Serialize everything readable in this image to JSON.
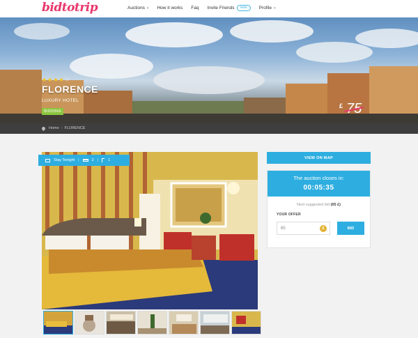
{
  "header": {
    "logo": "bidtotrip",
    "nav": [
      {
        "label": "Auctions",
        "chevron": true
      },
      {
        "label": "How it works"
      },
      {
        "label": "Faq"
      },
      {
        "label": "Invite Friends",
        "badge": "new"
      },
      {
        "label": "Profile",
        "chevron": true
      }
    ]
  },
  "hero": {
    "rating": {
      "filled": 4,
      "total": 5
    },
    "city": "FLORENCE",
    "hotel_type": "LUXURY HOTEL",
    "status_badge": "BIDDING",
    "currency": "£",
    "price": "75"
  },
  "breadcrumb": {
    "home": "Home",
    "separator": "›",
    "current": "FLORENCE"
  },
  "photo_info": {
    "stay": "Stay Tonight",
    "beds": "2",
    "baths": "1"
  },
  "thumbnails_count": 7,
  "panel": {
    "map_button": "VIEW ON MAP",
    "closes_label": "The auction closes in:",
    "countdown": "00:05:35",
    "next_bid_label": "Next suggested bid",
    "next_bid_value": "(65 £)",
    "offer_label": "YOUR OFFER",
    "offer_value": "65",
    "offer_currency": "£",
    "bid_button": "BID"
  },
  "colors": {
    "brand": "#e8376d",
    "accent": "#2eaee0",
    "badge": "#8cc63f",
    "currency_coin": "#e3b232"
  }
}
